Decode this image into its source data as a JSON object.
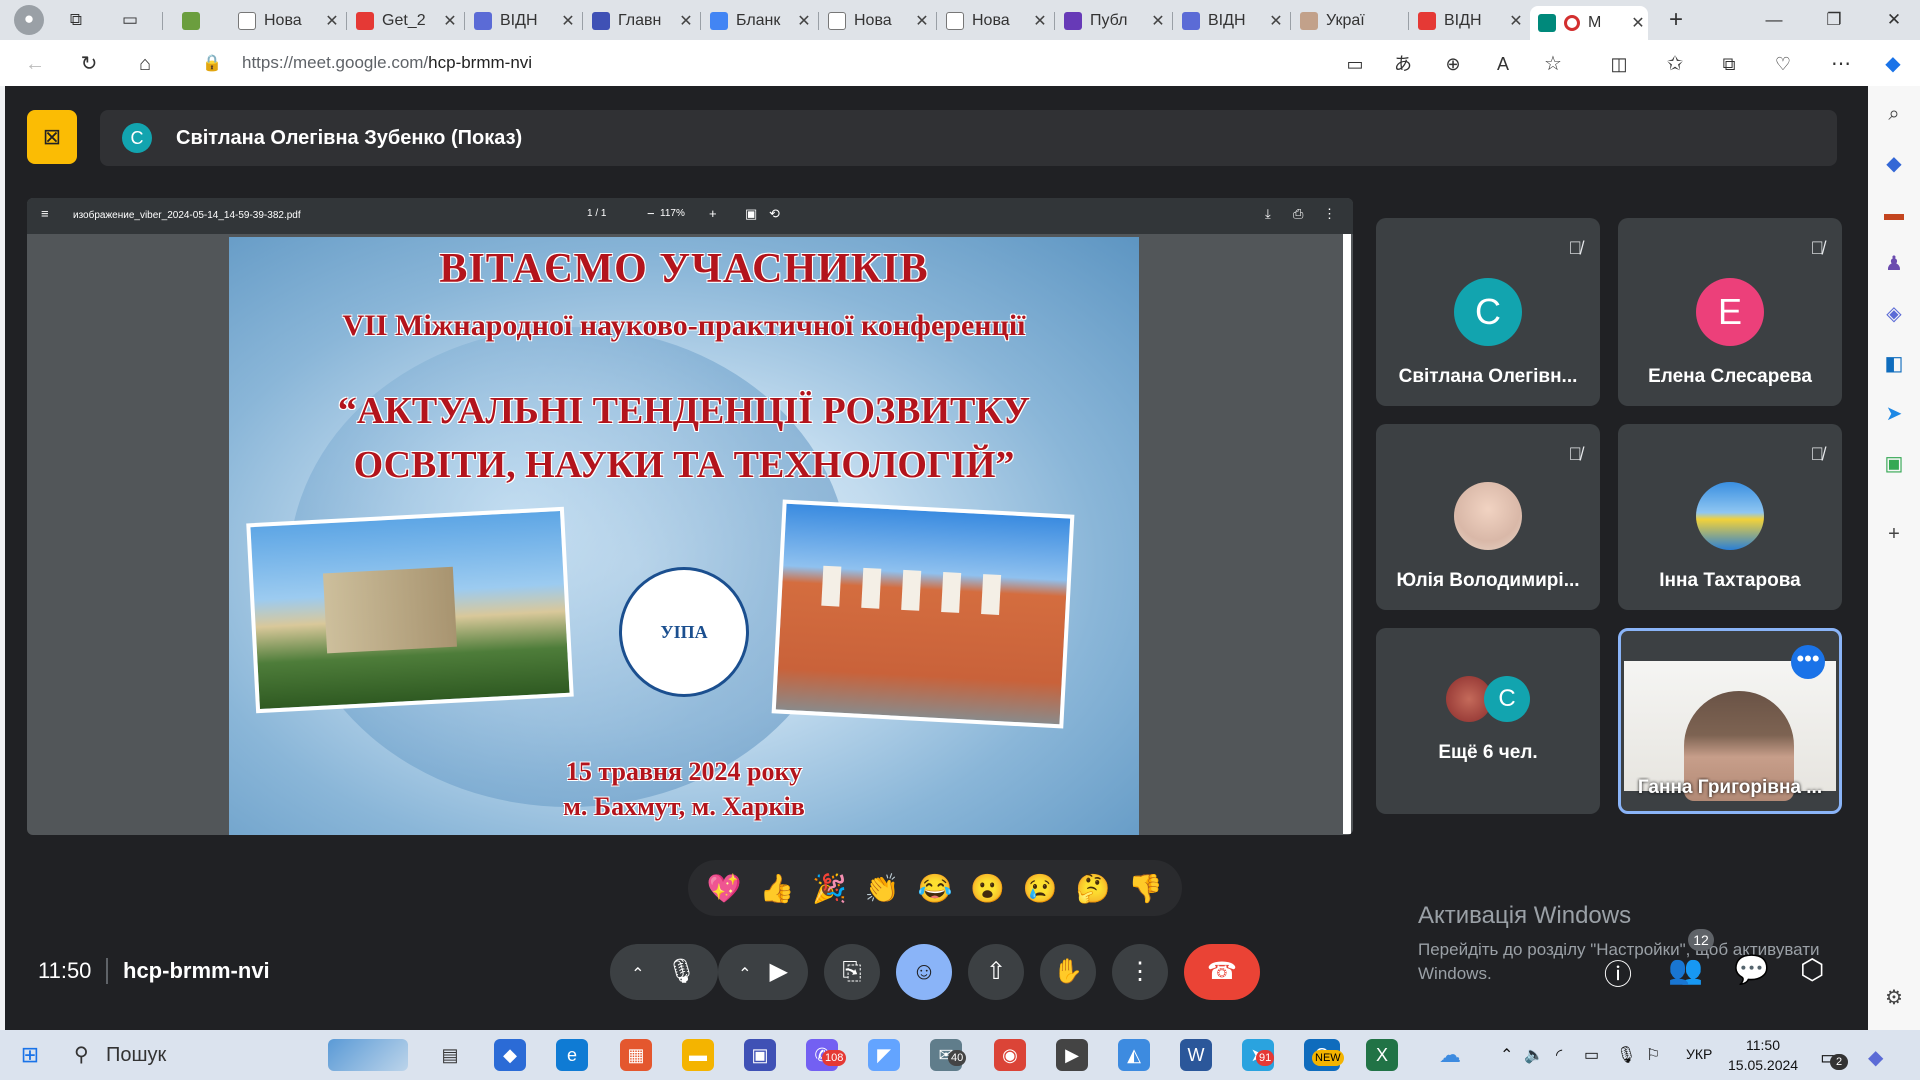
{
  "browser": {
    "tabs": [
      {
        "label": "",
        "color": "#6b9e3e"
      },
      {
        "label": "Нова",
        "color": "#ffffff"
      },
      {
        "label": "Get_2",
        "color": "#e53935"
      },
      {
        "label": "ВІДН",
        "color": "#5b6bd6"
      },
      {
        "label": "Главн",
        "color": "#3f51b5"
      },
      {
        "label": "Бланк",
        "color": "#4285f4"
      },
      {
        "label": "Нова",
        "color": "#ffffff"
      },
      {
        "label": "Нова",
        "color": "#ffffff"
      },
      {
        "label": "Публ",
        "color": "#673ab7"
      },
      {
        "label": "ВІДН",
        "color": "#5b6bd6"
      },
      {
        "label": "Украї",
        "color": "#c2a18a"
      },
      {
        "label": "ВІДН",
        "color": "#e53935"
      },
      {
        "label": "М",
        "color": "#00897b"
      }
    ],
    "url_host": "https://meet.google.com/",
    "url_path": "hcp-brmm-nvi",
    "new_tab": "+",
    "window_controls": [
      "—",
      "❐",
      "✕"
    ]
  },
  "presentation": {
    "avatar_letter": "С",
    "avatar_color": "#12a4af",
    "title": "Світлана Олегівна Зубенко (Показ)"
  },
  "pdf": {
    "filename": "изображение_viber_2024-05-14_14-59-39-382.pdf",
    "page": "1 / 1",
    "zoom": "117%"
  },
  "slide": {
    "line1": "ВІТАЄМО УЧАСНИКІВ",
    "line2": "VII Міжнародної науково-практичної конференції",
    "line3": "“АКТУАЛЬНІ ТЕНДЕНЦІЇ РОЗВИТКУ",
    "line4": "ОСВІТИ, НАУКИ ТА ТЕХНОЛОГІЙ”",
    "logo_text": "УІПА",
    "date": "15 травня 2024 року",
    "place": "м. Бахмут, м. Харків"
  },
  "participants": [
    {
      "name": "Світлана Олегівн...",
      "letter": "С",
      "color": "#12a4af",
      "muted": true
    },
    {
      "name": "Елена Слесарева",
      "letter": "Е",
      "color": "#ec407a",
      "muted": true
    },
    {
      "name": "Юлія Володимирі...",
      "letter": "",
      "color": "#d9b8a8",
      "muted": true
    },
    {
      "name": "Інна Тахтарова",
      "letter": "",
      "color": "#2a7fd6",
      "muted": true
    },
    {
      "name": "Ещё 6 чел.",
      "letter": "С",
      "color": "#12a4af",
      "muted": false
    },
    {
      "name": "Ганна Григорівна ...",
      "letter": "",
      "color": "#f0f0ee",
      "muted": false
    }
  ],
  "reactions": [
    "💖",
    "👍",
    "🎉",
    "👏",
    "😂",
    "😮",
    "😢",
    "🤔",
    "👎"
  ],
  "footer": {
    "time": "11:50",
    "code": "hcp-brmm-nvi",
    "participant_count": "12"
  },
  "watermark": {
    "title": "Активація Windows",
    "body": "Перейдіть до розділу \"Настройки\", щоб активувати Windows."
  },
  "taskbar": {
    "search_label": "Пошук",
    "lang": "УКР",
    "time": "11:50",
    "date": "15.05.2024",
    "badges": {
      "viber": "108",
      "mail": "40",
      "telegram": "91",
      "notifications": "2"
    },
    "outlook_label": "NEW"
  }
}
